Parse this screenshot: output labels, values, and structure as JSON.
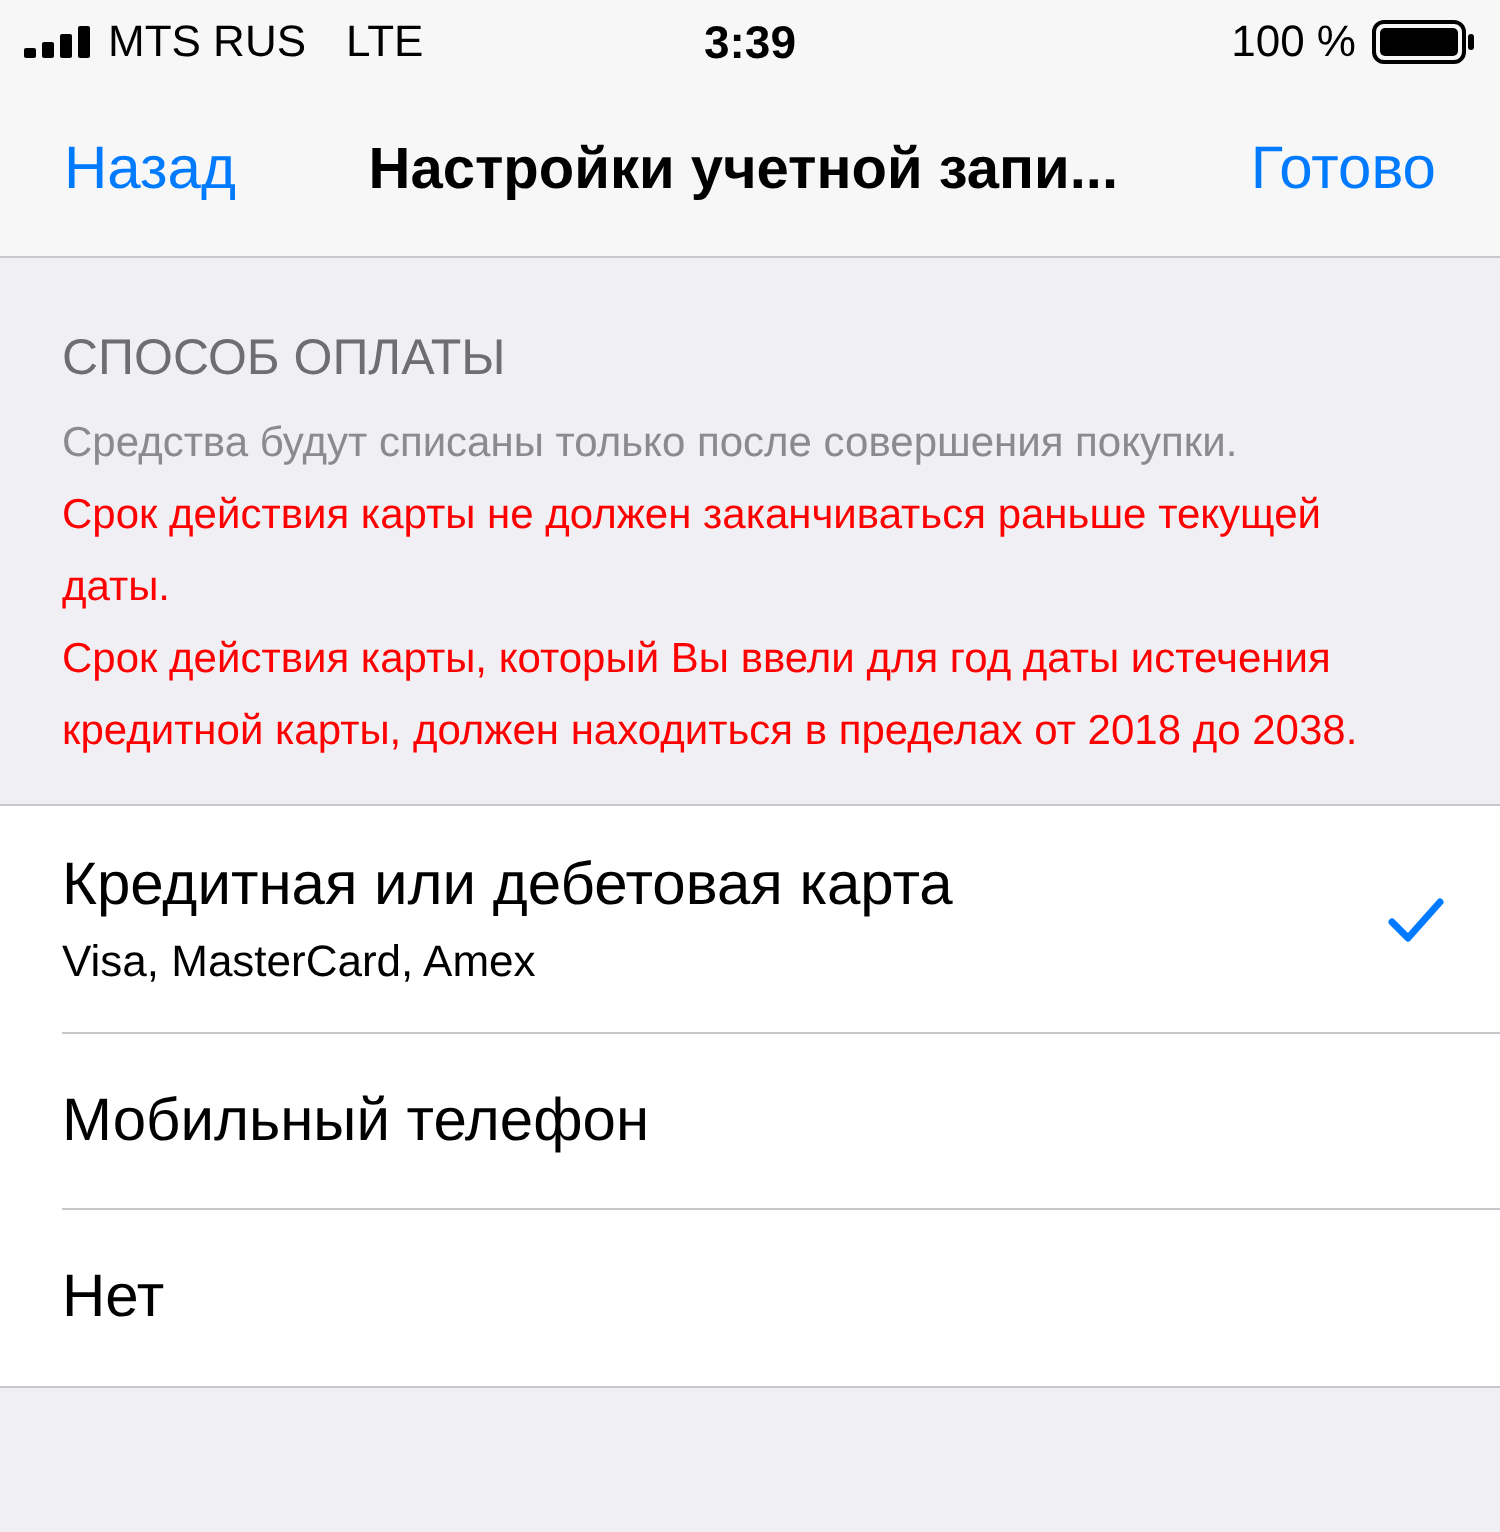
{
  "status_bar": {
    "carrier": "MTS RUS",
    "network": "LTE",
    "time": "3:39",
    "battery": "100 %"
  },
  "nav": {
    "back": "Назад",
    "title": "Настройки учетной запи...",
    "done": "Готово"
  },
  "section": {
    "header": "СПОСОБ ОПЛАТЫ",
    "notes": [
      {
        "kind": "info",
        "text": "Средства будут списаны только после совершения покупки."
      },
      {
        "kind": "error",
        "text": "Срок действия карты не должен заканчиваться раньше текущей даты."
      },
      {
        "kind": "error",
        "text": "Срок действия карты, который Вы ввели для год даты истечения кредитной карты, должен находиться в пределах от 2018 до 2038."
      }
    ]
  },
  "options": [
    {
      "title": "Кредитная или дебетовая карта",
      "subtitle": "Visa, MasterCard, Amex",
      "selected": true
    },
    {
      "title": "Мобильный телефон",
      "selected": false
    },
    {
      "title": "Нет",
      "selected": false
    }
  ]
}
